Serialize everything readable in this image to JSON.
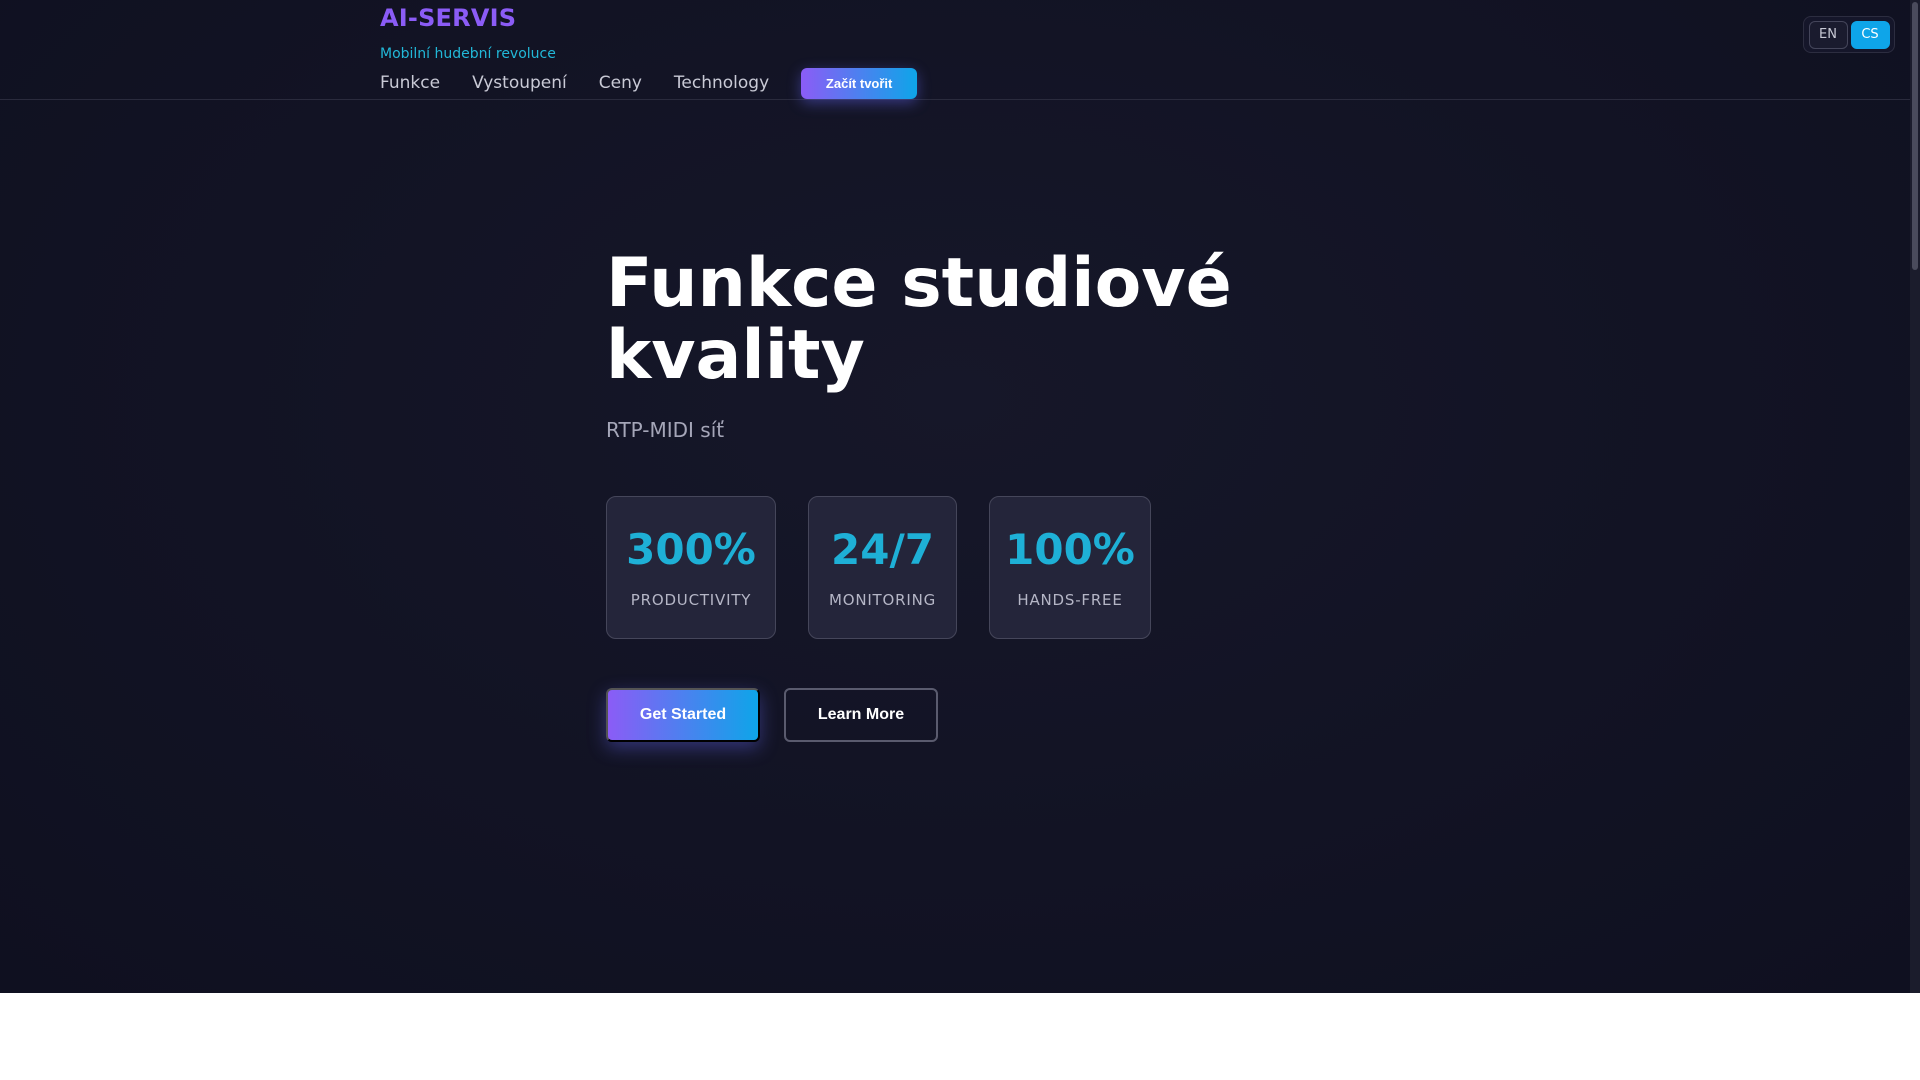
{
  "header": {
    "brand": "AI-SERVIS",
    "tagline": "Mobilní hudební revoluce",
    "nav": [
      {
        "label": "Funkce"
      },
      {
        "label": "Vystoupení"
      },
      {
        "label": "Ceny"
      },
      {
        "label": "Technology"
      }
    ],
    "cta_label": "Začít tvořit",
    "languages": [
      {
        "code": "EN",
        "active": false
      },
      {
        "code": "CS",
        "active": true
      }
    ]
  },
  "hero": {
    "title": "Funkce studiové kvality",
    "subtitle": "RTP-MIDI síť",
    "stats": [
      {
        "value": "300%",
        "label": "PRODUCTIVITY"
      },
      {
        "value": "24/7",
        "label": "MONITORING"
      },
      {
        "value": "100%",
        "label": "HANDS-FREE"
      }
    ],
    "primary_button": "Get Started",
    "secondary_button": "Learn More"
  },
  "colors": {
    "background": "#121324",
    "brand": "#8b5cf6",
    "accent": "#0ea5e9",
    "stat_value": "#1eb0d6"
  }
}
